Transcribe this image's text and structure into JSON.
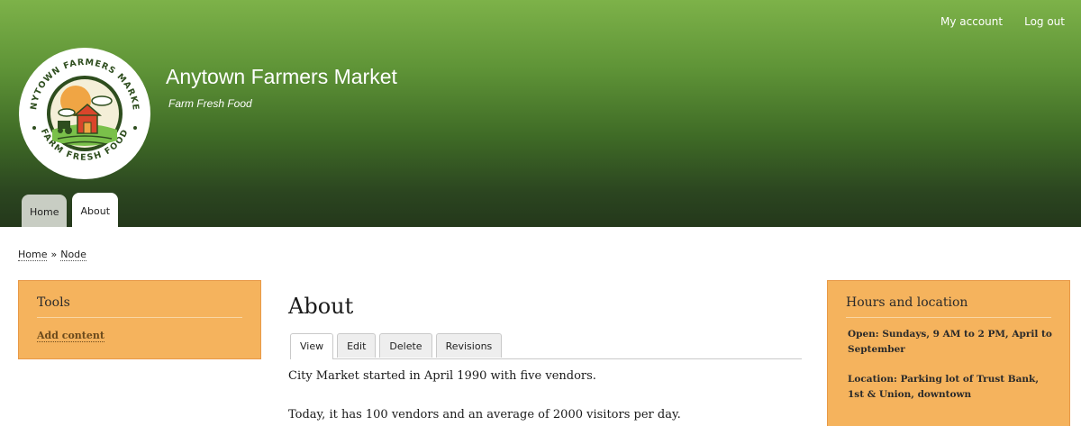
{
  "header": {
    "site_name": "Anytown Farmers Market",
    "slogan": "Farm Fresh Food",
    "secondary_menu": [
      "My account",
      "Log out"
    ],
    "logo_text_top": "ANYTOWN FARMERS MARKET",
    "logo_text_bottom": "FARM FRESH FOOD",
    "primary_tabs": [
      {
        "label": "Home",
        "active": false
      },
      {
        "label": "About",
        "active": true
      }
    ]
  },
  "breadcrumb": {
    "items": [
      "Home",
      "Node"
    ],
    "separator": "»"
  },
  "sidebar_left": {
    "title": "Tools",
    "links": [
      "Add content"
    ]
  },
  "sidebar_right": {
    "title": "Hours and location",
    "paragraphs": [
      "Open: Sundays, 9 AM to 2 PM, April to September",
      "Location: Parking lot of Trust Bank, 1st & Union, downtown"
    ]
  },
  "main": {
    "title": "About",
    "tabs": [
      {
        "label": "View",
        "active": true
      },
      {
        "label": "Edit",
        "active": false
      },
      {
        "label": "Delete",
        "active": false
      },
      {
        "label": "Revisions",
        "active": false
      }
    ],
    "paragraphs": [
      "City Market started in April 1990 with five vendors.",
      "Today, it has 100 vendors and an average of 2000 visitors per day."
    ]
  },
  "colors": {
    "header_top": "#7db249",
    "header_bottom": "#24381b",
    "sidebar_block": "#f5b35d"
  }
}
